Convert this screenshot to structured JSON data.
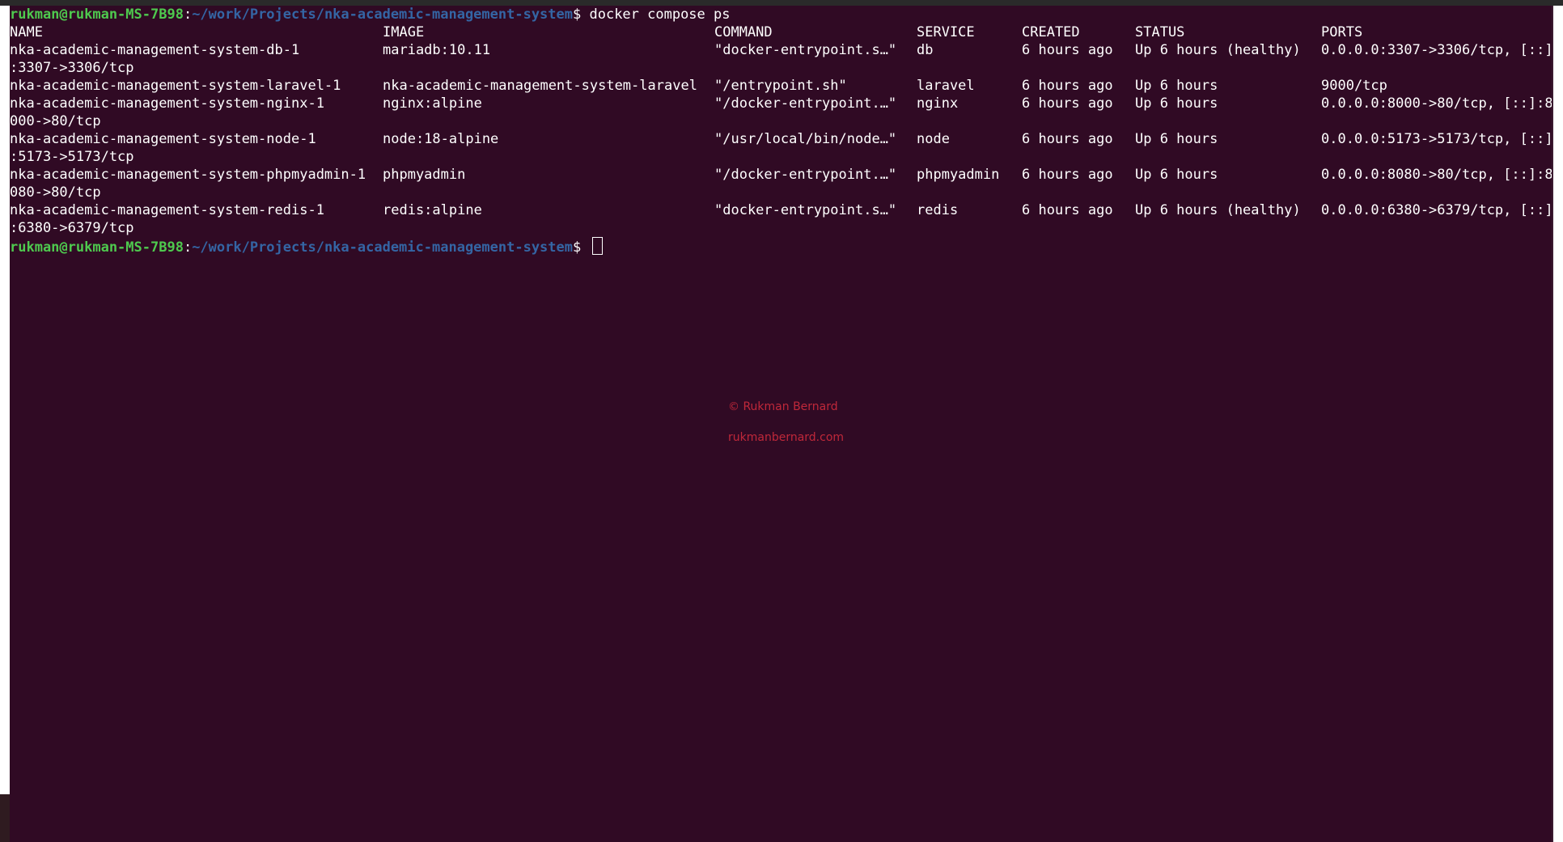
{
  "prompt": {
    "user_host": "rukman@rukman-MS-7B98",
    "colon": ":",
    "path": "~/work/Projects/nka-academic-management-system",
    "dollar": "$ ",
    "command": "docker compose ps"
  },
  "table": {
    "headers": {
      "name": "NAME",
      "image": "IMAGE",
      "command": "COMMAND",
      "service": "SERVICE",
      "created": "CREATED",
      "status": "STATUS",
      "ports": "PORTS"
    },
    "rows": [
      {
        "name": "nka-academic-management-system-db-1",
        "image": "mariadb:10.11",
        "command": "\"docker-entrypoint.s…\"",
        "service": "db",
        "created": "6 hours ago",
        "status": "Up 6 hours (healthy)",
        "ports": "0.0.0.0:3307->3306/tcp, [::]",
        "ports_wrap": ":3307->3306/tcp"
      },
      {
        "name": "nka-academic-management-system-laravel-1",
        "image": "nka-academic-management-system-laravel",
        "command": "\"/entrypoint.sh\"",
        "service": "laravel",
        "created": "6 hours ago",
        "status": "Up 6 hours",
        "ports": "9000/tcp",
        "ports_wrap": ""
      },
      {
        "name": "nka-academic-management-system-nginx-1",
        "image": "nginx:alpine",
        "command": "\"/docker-entrypoint.…\"",
        "service": "nginx",
        "created": "6 hours ago",
        "status": "Up 6 hours",
        "ports": "0.0.0.0:8000->80/tcp, [::]:8",
        "ports_wrap": "000->80/tcp"
      },
      {
        "name": "nka-academic-management-system-node-1",
        "image": "node:18-alpine",
        "command": "\"/usr/local/bin/node…\"",
        "service": "node",
        "created": "6 hours ago",
        "status": "Up 6 hours",
        "ports": "0.0.0.0:5173->5173/tcp, [::]",
        "ports_wrap": ":5173->5173/tcp"
      },
      {
        "name": "nka-academic-management-system-phpmyadmin-1",
        "image": "phpmyadmin",
        "command": "\"/docker-entrypoint.…\"",
        "service": "phpmyadmin",
        "created": "6 hours ago",
        "status": "Up 6 hours",
        "ports": "0.0.0.0:8080->80/tcp, [::]:8",
        "ports_wrap": "080->80/tcp"
      },
      {
        "name": "nka-academic-management-system-redis-1",
        "image": "redis:alpine",
        "command": "\"docker-entrypoint.s…\"",
        "service": "redis",
        "created": "6 hours ago",
        "status": "Up 6 hours (healthy)",
        "ports": "0.0.0.0:6380->6379/tcp, [::]",
        "ports_wrap": ":6380->6379/tcp"
      }
    ]
  },
  "watermark": {
    "copyright": "© Rukman Bernard",
    "site": "rukmanbernard.com"
  },
  "colors": {
    "background": "#300a24",
    "prompt_user": "#4ec94e",
    "prompt_path": "#3465a4",
    "watermark": "#c0283a"
  }
}
